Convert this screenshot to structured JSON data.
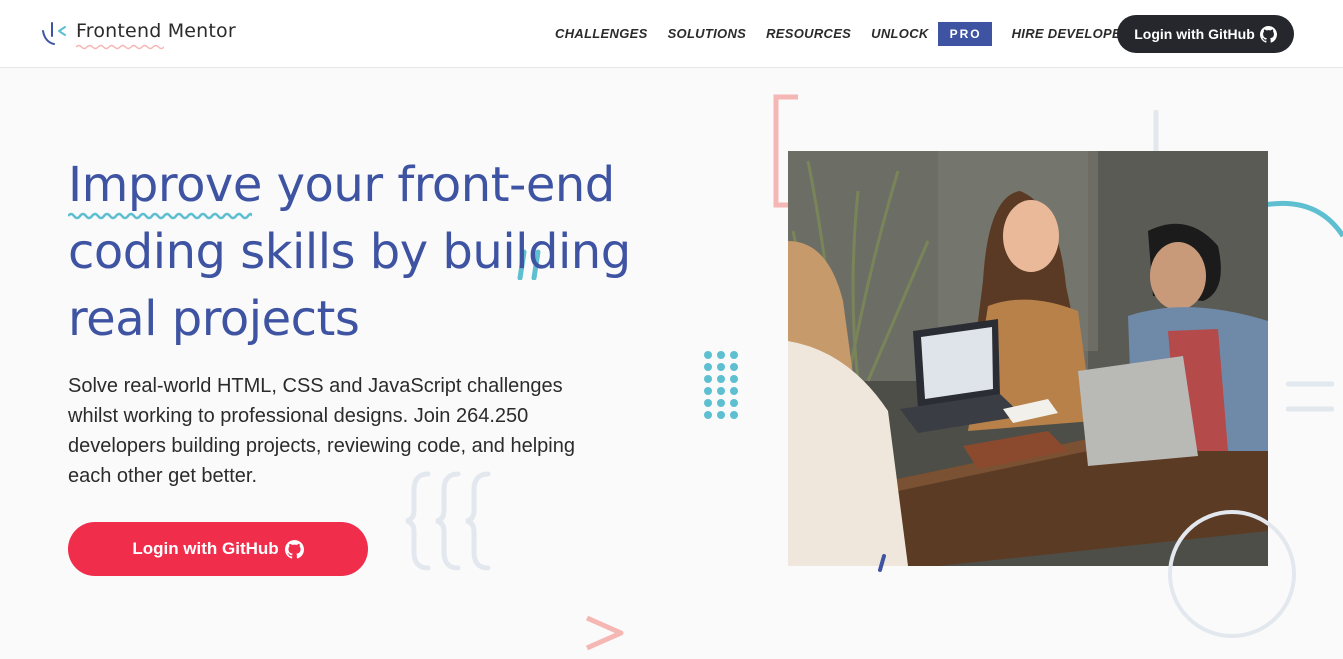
{
  "brand": {
    "name": "Frontend Mentor"
  },
  "nav": {
    "items": [
      "CHALLENGES",
      "SOLUTIONS",
      "RESOURCES"
    ],
    "unlock_label": "UNLOCK",
    "pro_badge": "PRO",
    "hire_label": "HIRE DEVELOPERS",
    "login_label": "Login with GitHub"
  },
  "hero": {
    "title_highlight": "Improve",
    "title_rest": " your front-end coding skills by building real projects",
    "description": "Solve real-world HTML, CSS and JavaScript challenges whilst working to professional designs. Join 264.250 developers building projects, reviewing code, and helping each other get better.",
    "cta_label": "Login with GitHub"
  },
  "colors": {
    "accent_blue": "#3e54a3",
    "cta_red": "#f02d4b",
    "dark": "#25272d",
    "teal": "#5ebfd1",
    "pink": "#f5b7b4"
  },
  "icons": [
    "frontend-mentor-logo-icon",
    "github-icon"
  ]
}
